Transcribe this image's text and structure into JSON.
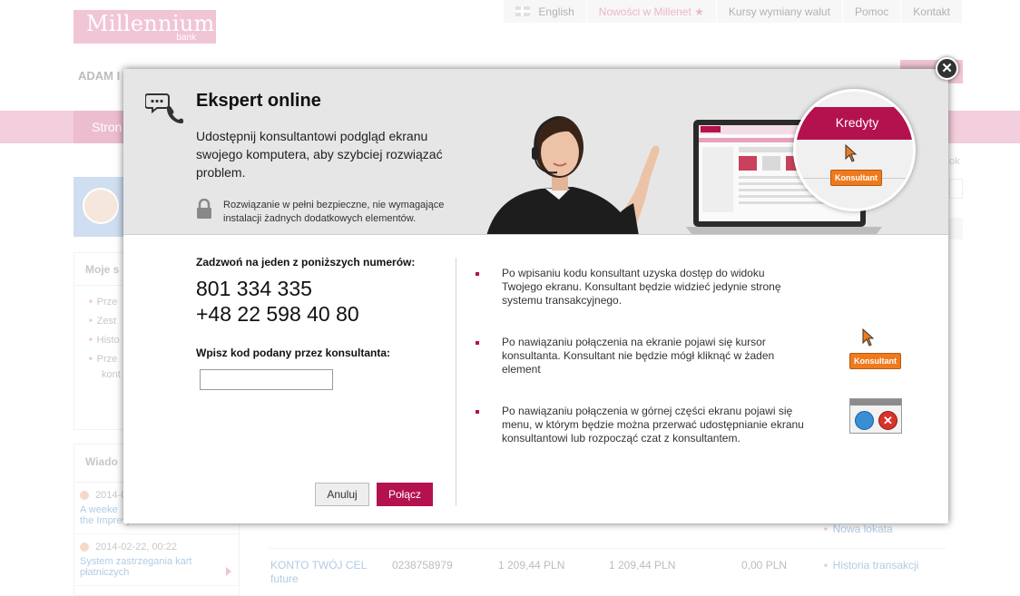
{
  "header": {
    "logo_text": "Millennium",
    "logo_sub": "bank",
    "links": [
      "English",
      "Nowości w Millenet ★",
      "Kursy wymiany walut",
      "Pomoc",
      "Kontakt"
    ],
    "user_name": "ADAM I",
    "nav_tab": "Stron"
  },
  "sidebar": {
    "box1_title": "Moje s",
    "box1_items": [
      "Prze",
      "Zest",
      "Histo",
      "Prze"
    ],
    "box1_items_extra": "kont",
    "box2_title": "Wiado",
    "news": [
      {
        "date": "2014-0",
        "text": "A weeke",
        "text2": "the Impresja Card"
      },
      {
        "date": "2014-02-22, 00:22",
        "text": "System zastrzegania kart",
        "text2": "płatniczych"
      }
    ]
  },
  "background_table": {
    "new_deposit": "Nowa lokata",
    "row": {
      "name": "KONTO TWÓJ CEL",
      "name2": "future",
      "number": "0238758979",
      "balance": "1 209,44 PLN",
      "available": "1 209,44 PLN",
      "blocked": "0,00 PLN",
      "action": "Historia transakcji"
    },
    "ok_fragment": "ok"
  },
  "modal": {
    "title": "Ekspert online",
    "lead": "Udostępnij konsultantowi podgląd ekranu swojego komputera, aby szybciej rozwiązać problem.",
    "security_note": "Rozwiązanie w pełni bezpieczne, nie wymagające instalacji żadnych dodatkowych elementów.",
    "magnifier_label": "Kredyty",
    "consultant_label": "Konsultant",
    "close_symbol": "✕",
    "call_label": "Zadzwoń na jeden z poniższych numerów:",
    "phone_numbers": [
      "801 334 335",
      "+48 22 598 40 80"
    ],
    "code_label": "Wpisz kod podany przez konsultanta:",
    "code_value": "",
    "cancel_label": "Anuluj",
    "connect_label": "Połącz",
    "info_items": [
      "Po wpisaniu kodu konsultant uzyska dostęp do widoku Twojego ekranu. Konsultant będzie widzieć jedynie stronę systemu transakcyjnego.",
      "Po nawiązaniu połączenia na ekranie pojawi się kursor konsultanta. Konsultant nie będzie mógł kliknąć w żaden element",
      "Po nawiązaniu połączenia w górnej części ekranu pojawi się menu, w którym będzie można przerwać udostępnianie ekranu konsultantowi lub rozpocząć czat z konsultantem."
    ],
    "illustration_consultant_label": "Konsultant",
    "illustration_close_symbol": "✕"
  },
  "colors": {
    "brand": "#b4114f",
    "brand_light": "#e9a6c0",
    "consultant_orange": "#ef7a1d"
  }
}
